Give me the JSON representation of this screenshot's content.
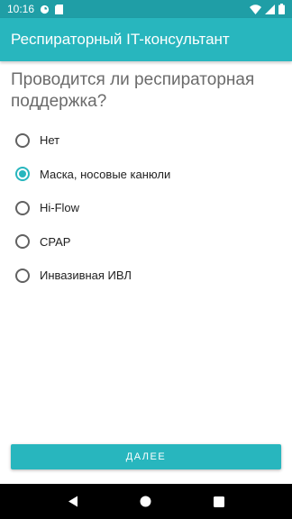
{
  "status_bar": {
    "time": "10:16",
    "icons_left": [
      "sync-icon",
      "sd-card-icon"
    ],
    "icons_right": [
      "wifi-icon",
      "cellular-icon",
      "battery-icon"
    ]
  },
  "app_bar": {
    "title": "Респираторный IT-консультант"
  },
  "question": {
    "text": "Проводится ли респираторная поддержка?"
  },
  "options": [
    {
      "label": "Нет",
      "checked": false
    },
    {
      "label": "Маска, носовые канюли",
      "checked": true
    },
    {
      "label": "Hi-Flow",
      "checked": false
    },
    {
      "label": "CPAP",
      "checked": false
    },
    {
      "label": "Инвазивная ИВЛ",
      "checked": false
    }
  ],
  "next_button": {
    "label": "ДАЛЕЕ"
  },
  "nav_bar": {
    "icons": [
      "back-icon",
      "home-icon",
      "recents-icon"
    ]
  },
  "colors": {
    "accent": "#28b6be",
    "status_bar": "#1f9ea6",
    "nav_bar": "#000000"
  }
}
